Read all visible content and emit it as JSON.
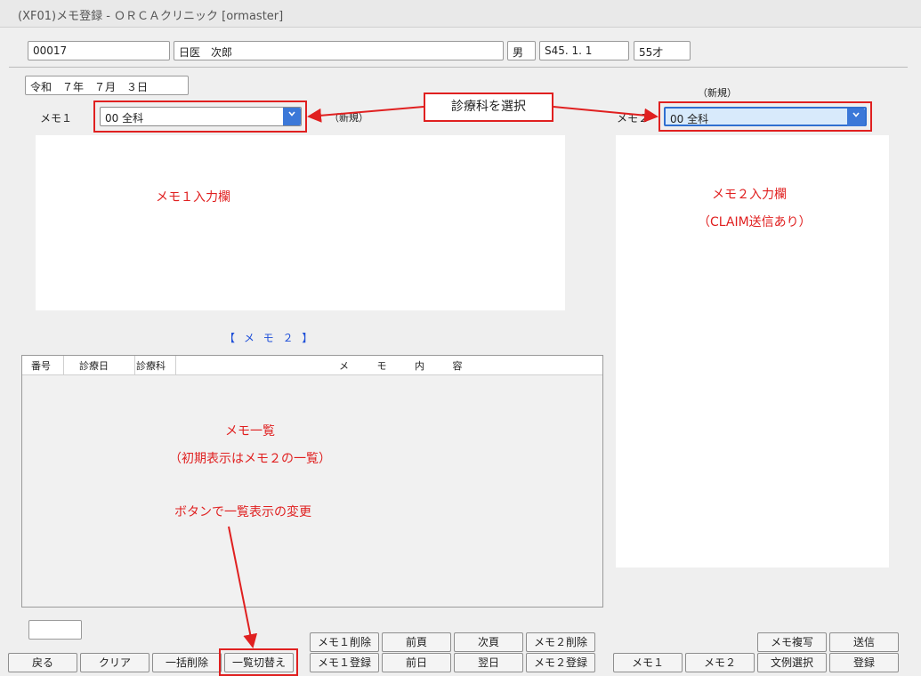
{
  "window": {
    "title": "(XF01)メモ登録 - ＯＲＣＡクリニック [ormaster]"
  },
  "patient": {
    "id": "00017",
    "name": "日医　次郎",
    "sex": "男",
    "birthdate": "S45. 1. 1",
    "age": "55才"
  },
  "date": "令和　７年　７月　３日",
  "memo1": {
    "label": "メモ１",
    "dept_value": "00 全科",
    "status": "（新規）",
    "annotation": "メモ１入力欄"
  },
  "memo2": {
    "label": "メモ２",
    "dept_value": "00 全科",
    "status": "（新規）",
    "annotation_line1": "メモ２入力欄",
    "annotation_line2": "（CLAIM送信あり）"
  },
  "callout": {
    "text": "診療科を選択"
  },
  "list": {
    "heading": "【 メ モ ２ 】",
    "columns": [
      "番号",
      "診療日",
      "診療科",
      "メ モ 内 容"
    ],
    "annotation_line1": "メモ一覧",
    "annotation_line2": "（初期表示はメモ２の一覧）",
    "annotation_line3": "ボタンで一覧表示の変更"
  },
  "page_input": {
    "value": ""
  },
  "buttons": {
    "back": "戻る",
    "clear": "クリア",
    "bulk_delete": "一括削除",
    "toggle_list": "一覧切替え",
    "memo1_delete": "メモ１削除",
    "memo1_register": "メモ１登録",
    "prev_page": "前頁",
    "prev_day": "前日",
    "next_page": "次頁",
    "next_day": "翌日",
    "memo2_delete": "メモ２削除",
    "memo2_register": "メモ２登録",
    "memo1": "メモ１",
    "memo2": "メモ２",
    "memo_copy": "メモ複写",
    "template_select": "文例選択",
    "send": "送信",
    "register": "登録"
  },
  "colors": {
    "annotation_red": "#e02020",
    "heading_blue": "#1e4fd8",
    "select_arrow": "#3b78d8"
  },
  "icons": {
    "dropdown": "chevron-down-icon"
  }
}
